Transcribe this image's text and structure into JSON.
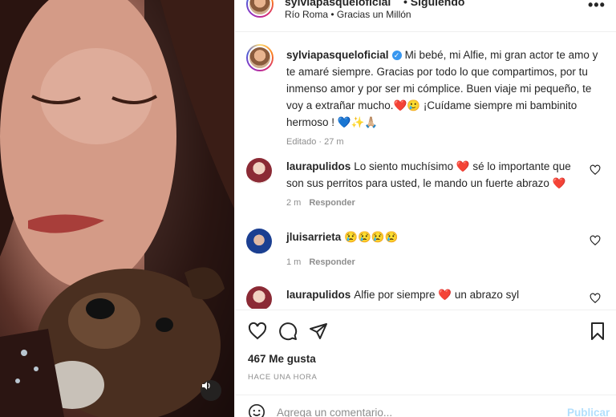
{
  "header": {
    "username": "sylviapasqueloficial",
    "follow_status": "• Siguiendo",
    "location": "Río Roma • Gracias un Millón",
    "more_icon": "more-horizontal-icon"
  },
  "caption": {
    "username": "sylviapasqueloficial",
    "text": "Mi bebé, mi Alfie, mi gran actor te amo y te amaré siempre. Gracias por todo lo que compartimos, por tu inmenso amor y por ser mi cómplice. Buen viaje mi pequeño, te voy a extrañar mucho.❤️🥲 ¡Cuídame siempre mi bambinito hermoso ! 💙✨🙏🏼",
    "meta": "Editado · 27 m"
  },
  "comments": [
    {
      "username": "laurapulidos",
      "text": "Lo siento muchísimo ❤️ sé lo importante que son sus perritos para usted, le mando un fuerte abrazo ❤️",
      "time": "2 m",
      "reply_label": "Responder"
    },
    {
      "username": "jluisarrieta",
      "text": "😢😢😢😢",
      "time": "1 m",
      "reply_label": "Responder"
    },
    {
      "username": "laurapulidos",
      "text": "Alfie por siempre ❤️ un abrazo syl",
      "time": "",
      "reply_label": ""
    }
  ],
  "stats": {
    "likes": "467 Me gusta",
    "posted": "HACE UNA HORA"
  },
  "add_comment": {
    "placeholder": "Agrega un comentario...",
    "publish_label": "Publicar"
  },
  "colors": {
    "link_blue": "#0095f6",
    "publish_disabled": "#b2dffc",
    "heart_red": "#ed4956",
    "muted_gray": "#8e8e8e"
  }
}
